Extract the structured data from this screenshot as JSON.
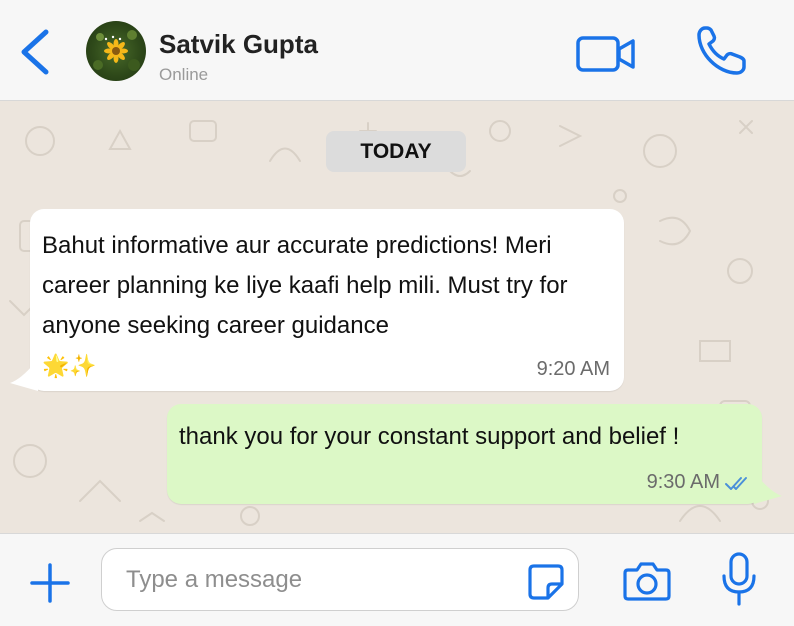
{
  "header": {
    "contact_name": "Satvik Gupta",
    "status": "Online",
    "icons": {
      "back": "chevron-left-icon",
      "video": "video-camera-icon",
      "call": "phone-icon"
    }
  },
  "chat": {
    "date_label": "TODAY",
    "messages": [
      {
        "direction": "incoming",
        "text": "Bahut informative aur accurate predictions! Meri career planning ke liye kaafi help mili. Must try for anyone seeking career guidance",
        "emoji": "🌟✨",
        "time": "9:20 AM"
      },
      {
        "direction": "outgoing",
        "text": "thank you for your constant support and belief !",
        "time": "9:30 AM",
        "read_status": "double-check-icon"
      }
    ]
  },
  "composer": {
    "placeholder": "Type a message",
    "value": "",
    "icons": {
      "attach": "plus-icon",
      "sticker": "sticker-icon",
      "camera": "camera-icon",
      "mic": "microphone-icon"
    }
  },
  "colors": {
    "accent": "#1a73e8",
    "incoming_bubble": "#ffffff",
    "outgoing_bubble": "#dcf8c6",
    "chat_background": "#ece5dd",
    "read_ticks": "#4a90d9"
  }
}
